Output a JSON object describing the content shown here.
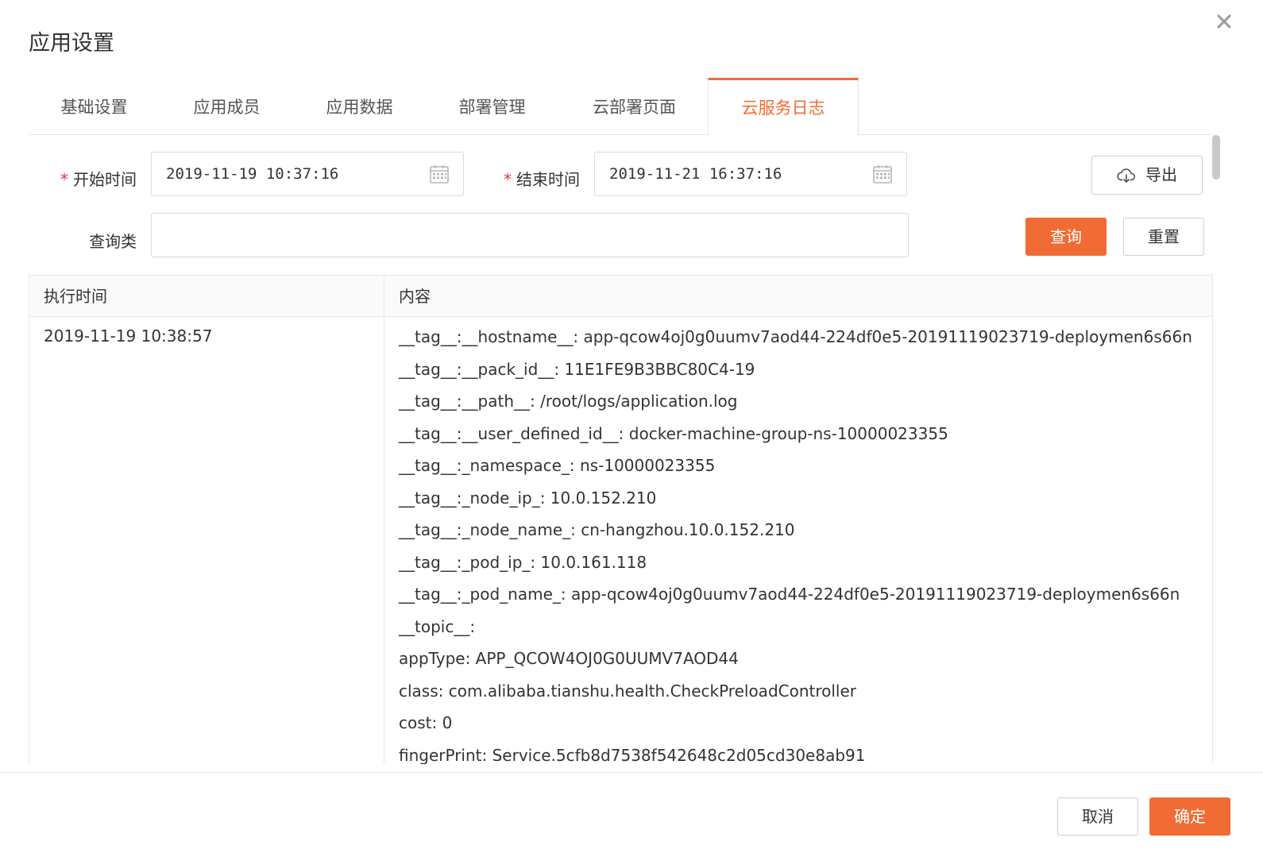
{
  "dialog": {
    "title": "应用设置"
  },
  "tabs": [
    {
      "label": "基础设置"
    },
    {
      "label": "应用成员"
    },
    {
      "label": "应用数据"
    },
    {
      "label": "部署管理"
    },
    {
      "label": "云部署页面"
    },
    {
      "label": "云服务日志",
      "active": true
    }
  ],
  "form": {
    "required_mark": "*",
    "start_label": "开始时间",
    "start_value": "2019-11-19 10:37:16",
    "end_label": "结束时间",
    "end_value": "2019-11-21 16:37:16",
    "query_label": "查询类",
    "query_value": "",
    "export_label": "导出",
    "search_label": "查询",
    "reset_label": "重置"
  },
  "table": {
    "headers": [
      "执行时间",
      "内容"
    ],
    "rows": [
      {
        "time": "2019-11-19 10:38:57",
        "lines": [
          "__tag__:__hostname__: app-qcow4oj0g0uumv7aod44-224df0e5-20191119023719-deploymen6s66n",
          "__tag__:__pack_id__: 11E1FE9B3BBC80C4-19",
          "__tag__:__path__: /root/logs/application.log",
          "__tag__:__user_defined_id__: docker-machine-group-ns-10000023355",
          "__tag__:_namespace_: ns-10000023355",
          "__tag__:_node_ip_: 10.0.152.210",
          "__tag__:_node_name_: cn-hangzhou.10.0.152.210",
          "__tag__:_pod_ip_: 10.0.161.118",
          "__tag__:_pod_name_: app-qcow4oj0g0uumv7aod44-224df0e5-20191119023719-deploymen6s66n",
          "__topic__:",
          "appType: APP_QCOW4OJ0G0UUMV7AOD44",
          "class: com.alibaba.tianshu.health.CheckPreloadController",
          "cost: 0",
          "fingerPrint: Service.5cfb8d7538f542648c2d05cd30e8ab91"
        ]
      }
    ]
  },
  "footer": {
    "cancel_label": "取消",
    "confirm_label": "确定"
  },
  "colors": {
    "accent": "#f06c34",
    "required": "#e8323c"
  }
}
